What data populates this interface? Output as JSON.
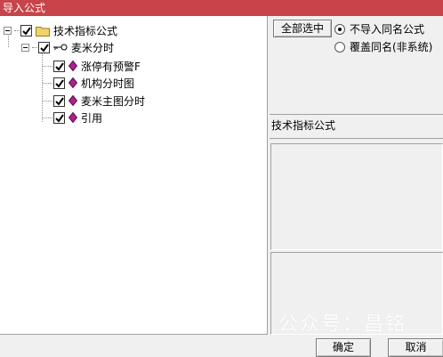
{
  "window": {
    "title": "导入公式"
  },
  "tree": {
    "root": {
      "label": "技术指标公式",
      "checked": true,
      "icon": "folder-icon"
    },
    "group": {
      "label": "麦米分时",
      "checked": true,
      "icon": "key-icon"
    },
    "items": [
      {
        "label": "涨停有预警F",
        "checked": true,
        "icon": "gem-icon"
      },
      {
        "label": "机构分时图",
        "checked": true,
        "icon": "gem-icon"
      },
      {
        "label": "麦米主图分时",
        "checked": true,
        "icon": "gem-icon"
      },
      {
        "label": "引用",
        "checked": true,
        "icon": "gem-icon"
      }
    ]
  },
  "options": {
    "select_all_label": "全部选中",
    "radio_no_import": "不导入同名公式",
    "radio_overwrite": "覆盖同名(非系统)",
    "selected": "radio_no_import"
  },
  "info": {
    "category_label": "技术指标公式"
  },
  "buttons": {
    "ok": "确定",
    "cancel": "取消"
  },
  "watermark": "公众号：昌铭",
  "colors": {
    "titlebar": "#c8434a",
    "gem": "#b0208f",
    "folder": "#f2d36b"
  }
}
